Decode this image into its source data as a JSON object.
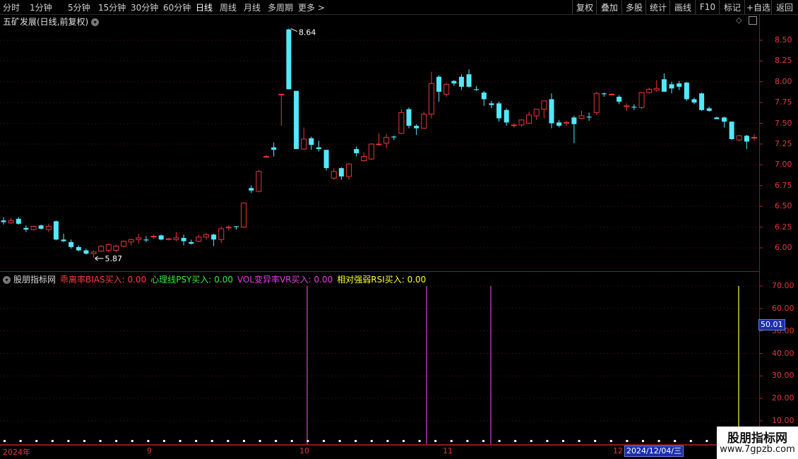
{
  "toolbar": {
    "periods": [
      "分时",
      "1分钟",
      "5分钟",
      "15分钟",
      "30分钟",
      "60分钟",
      "日线",
      "周线",
      "月线",
      "多周期",
      "更多 >"
    ],
    "active_period": "日线",
    "right_buttons": [
      "复权",
      "叠加",
      "多股",
      "统计",
      "画线",
      "F10",
      "标记",
      "+自选",
      "返回"
    ]
  },
  "chart": {
    "title": "五矿发展(日线,前复权)",
    "high_marker": "8.64",
    "low_marker": "5.87",
    "price_ticks": [
      "8.50",
      "8.25",
      "8.00",
      "7.75",
      "7.50",
      "7.25",
      "7.00",
      "6.75",
      "6.50",
      "6.25",
      "6.00"
    ],
    "colors": {
      "up": "#e23a3a",
      "down": "#54e8ff",
      "magenta": "#e040e0",
      "yellow": "#ffff33"
    }
  },
  "indicator": {
    "name": "股朋指标网",
    "items": [
      {
        "label": "乖离率BIAS买入: 0.00",
        "color": "#ff3b3b"
      },
      {
        "label": "心理线PSY买入: 0.00",
        "color": "#3ce63c"
      },
      {
        "label": "VOL变异率VR买入: 0.00",
        "color": "#e040e0"
      },
      {
        "label": "相对强弱RSI买入: 0.00",
        "color": "#ffff33"
      }
    ],
    "ticks": [
      "70.00",
      "60.00",
      "50.00",
      "40.00",
      "30.00",
      "20.00",
      "10.00"
    ],
    "current_value": "50.01"
  },
  "date_axis": {
    "labels": [
      "2024年",
      "9",
      "10",
      "11",
      "12"
    ],
    "cursor": "2024/12/04/三"
  },
  "watermark": {
    "title": "股朋指标网",
    "url": "www.7gpzb.com"
  },
  "chart_data": {
    "type": "candlestick",
    "title": "五矿发展(日线,前复权)",
    "y_range": [
      5.8,
      8.75
    ],
    "candles": [
      {
        "o": 6.33,
        "h": 6.37,
        "l": 6.28,
        "c": 6.31
      },
      {
        "o": 6.3,
        "h": 6.36,
        "l": 6.29,
        "c": 6.33
      },
      {
        "o": 6.35,
        "h": 6.37,
        "l": 6.28,
        "c": 6.29
      },
      {
        "o": 6.24,
        "h": 6.27,
        "l": 6.19,
        "c": 6.22
      },
      {
        "o": 6.22,
        "h": 6.27,
        "l": 6.21,
        "c": 6.26
      },
      {
        "o": 6.27,
        "h": 6.28,
        "l": 6.22,
        "c": 6.23
      },
      {
        "o": 6.22,
        "h": 6.29,
        "l": 6.19,
        "c": 6.26
      },
      {
        "o": 6.32,
        "h": 6.33,
        "l": 6.09,
        "c": 6.1
      },
      {
        "o": 6.1,
        "h": 6.17,
        "l": 6.07,
        "c": 6.08
      },
      {
        "o": 6.07,
        "h": 6.1,
        "l": 5.99,
        "c": 6.01
      },
      {
        "o": 6.01,
        "h": 6.03,
        "l": 5.96,
        "c": 5.97
      },
      {
        "o": 5.97,
        "h": 5.99,
        "l": 5.92,
        "c": 5.93
      },
      {
        "o": 5.93,
        "h": 5.97,
        "l": 5.88,
        "c": 5.95
      },
      {
        "o": 5.96,
        "h": 6.03,
        "l": 5.95,
        "c": 6.02
      },
      {
        "o": 5.97,
        "h": 6.05,
        "l": 5.95,
        "c": 6.04
      },
      {
        "o": 5.97,
        "h": 6.04,
        "l": 5.95,
        "c": 6.02
      },
      {
        "o": 6.02,
        "h": 6.09,
        "l": 6.01,
        "c": 6.08
      },
      {
        "o": 6.07,
        "h": 6.11,
        "l": 6.03,
        "c": 6.1
      },
      {
        "o": 6.1,
        "h": 6.17,
        "l": 6.05,
        "c": 6.12
      },
      {
        "o": 6.1,
        "h": 6.14,
        "l": 6.07,
        "c": 6.09
      },
      {
        "o": 6.14,
        "h": 6.16,
        "l": 6.11,
        "c": 6.14
      },
      {
        "o": 6.15,
        "h": 6.16,
        "l": 6.09,
        "c": 6.1
      },
      {
        "o": 6.1,
        "h": 6.12,
        "l": 6.09,
        "c": 6.11
      },
      {
        "o": 6.1,
        "h": 6.19,
        "l": 6.08,
        "c": 6.12
      },
      {
        "o": 6.12,
        "h": 6.16,
        "l": 6.03,
        "c": 6.08
      },
      {
        "o": 6.07,
        "h": 6.1,
        "l": 6.04,
        "c": 6.05
      },
      {
        "o": 6.08,
        "h": 6.16,
        "l": 6.07,
        "c": 6.13
      },
      {
        "o": 6.13,
        "h": 6.18,
        "l": 6.1,
        "c": 6.16
      },
      {
        "o": 6.16,
        "h": 6.17,
        "l": 6.02,
        "c": 6.1
      },
      {
        "o": 6.1,
        "h": 6.26,
        "l": 6.06,
        "c": 6.23
      },
      {
        "o": 6.24,
        "h": 6.27,
        "l": 6.21,
        "c": 6.25
      },
      {
        "o": 6.26,
        "h": 6.26,
        "l": 6.22,
        "c": 6.25
      },
      {
        "o": 6.25,
        "h": 6.54,
        "l": 6.24,
        "c": 6.54
      },
      {
        "o": 6.72,
        "h": 6.75,
        "l": 6.66,
        "c": 6.69
      },
      {
        "o": 6.68,
        "h": 6.94,
        "l": 6.67,
        "c": 6.92
      },
      {
        "o": 7.1,
        "h": 7.12,
        "l": 7.1,
        "c": 7.1
      },
      {
        "o": 7.21,
        "h": 7.27,
        "l": 7.1,
        "c": 7.18
      },
      {
        "o": 7.85,
        "h": 7.85,
        "l": 7.47,
        "c": 7.85
      },
      {
        "o": 8.63,
        "h": 8.64,
        "l": 7.91,
        "c": 7.91
      },
      {
        "o": 7.89,
        "h": 7.89,
        "l": 7.23,
        "c": 7.19
      },
      {
        "o": 7.19,
        "h": 7.45,
        "l": 7.18,
        "c": 7.31
      },
      {
        "o": 7.32,
        "h": 7.34,
        "l": 7.18,
        "c": 7.24
      },
      {
        "o": 7.21,
        "h": 7.29,
        "l": 7.16,
        "c": 7.19
      },
      {
        "o": 7.18,
        "h": 7.18,
        "l": 6.93,
        "c": 6.96
      },
      {
        "o": 6.84,
        "h": 6.96,
        "l": 6.82,
        "c": 6.92
      },
      {
        "o": 6.96,
        "h": 6.97,
        "l": 6.82,
        "c": 6.86
      },
      {
        "o": 6.86,
        "h": 7.02,
        "l": 6.82,
        "c": 7.01
      },
      {
        "o": 7.19,
        "h": 7.22,
        "l": 7.1,
        "c": 7.14
      },
      {
        "o": 7.05,
        "h": 7.15,
        "l": 7.04,
        "c": 7.1
      },
      {
        "o": 7.07,
        "h": 7.26,
        "l": 7.06,
        "c": 7.25
      },
      {
        "o": 7.25,
        "h": 7.38,
        "l": 7.23,
        "c": 7.25
      },
      {
        "o": 7.26,
        "h": 7.37,
        "l": 7.2,
        "c": 7.33
      },
      {
        "o": 7.34,
        "h": 7.35,
        "l": 7.3,
        "c": 7.33
      },
      {
        "o": 7.38,
        "h": 7.67,
        "l": 7.37,
        "c": 7.63
      },
      {
        "o": 7.67,
        "h": 7.69,
        "l": 7.44,
        "c": 7.47
      },
      {
        "o": 7.47,
        "h": 7.49,
        "l": 7.36,
        "c": 7.44
      },
      {
        "o": 7.44,
        "h": 7.64,
        "l": 7.44,
        "c": 7.61
      },
      {
        "o": 7.61,
        "h": 8.12,
        "l": 7.56,
        "c": 7.98
      },
      {
        "o": 8.06,
        "h": 8.08,
        "l": 7.76,
        "c": 7.88
      },
      {
        "o": 7.85,
        "h": 7.99,
        "l": 7.82,
        "c": 7.97
      },
      {
        "o": 8.01,
        "h": 8.02,
        "l": 7.95,
        "c": 7.98
      },
      {
        "o": 8.06,
        "h": 8.09,
        "l": 7.9,
        "c": 7.94
      },
      {
        "o": 8.09,
        "h": 8.15,
        "l": 7.93,
        "c": 7.94
      },
      {
        "o": 7.91,
        "h": 7.95,
        "l": 7.89,
        "c": 7.9
      },
      {
        "o": 7.87,
        "h": 7.89,
        "l": 7.71,
        "c": 7.79
      },
      {
        "o": 7.74,
        "h": 7.77,
        "l": 7.68,
        "c": 7.72
      },
      {
        "o": 7.74,
        "h": 7.76,
        "l": 7.52,
        "c": 7.56
      },
      {
        "o": 7.66,
        "h": 7.68,
        "l": 7.47,
        "c": 7.51
      },
      {
        "o": 7.48,
        "h": 7.5,
        "l": 7.45,
        "c": 7.48
      },
      {
        "o": 7.48,
        "h": 7.55,
        "l": 7.46,
        "c": 7.54
      },
      {
        "o": 7.5,
        "h": 7.64,
        "l": 7.49,
        "c": 7.6
      },
      {
        "o": 7.59,
        "h": 7.66,
        "l": 7.54,
        "c": 7.67
      },
      {
        "o": 7.67,
        "h": 7.71,
        "l": 7.56,
        "c": 7.77
      },
      {
        "o": 7.79,
        "h": 7.86,
        "l": 7.44,
        "c": 7.5
      },
      {
        "o": 7.51,
        "h": 7.54,
        "l": 7.45,
        "c": 7.47
      },
      {
        "o": 7.5,
        "h": 7.53,
        "l": 7.47,
        "c": 7.51
      },
      {
        "o": 7.57,
        "h": 7.59,
        "l": 7.26,
        "c": 7.49
      },
      {
        "o": 7.56,
        "h": 7.65,
        "l": 7.55,
        "c": 7.59
      },
      {
        "o": 7.58,
        "h": 7.63,
        "l": 7.53,
        "c": 7.57
      },
      {
        "o": 7.63,
        "h": 7.88,
        "l": 7.6,
        "c": 7.86
      },
      {
        "o": 7.86,
        "h": 7.87,
        "l": 7.82,
        "c": 7.85
      },
      {
        "o": 7.85,
        "h": 7.86,
        "l": 7.84,
        "c": 7.85
      },
      {
        "o": 7.82,
        "h": 7.84,
        "l": 7.73,
        "c": 7.76
      },
      {
        "o": 7.7,
        "h": 7.74,
        "l": 7.65,
        "c": 7.71
      },
      {
        "o": 7.7,
        "h": 7.73,
        "l": 7.66,
        "c": 7.69
      },
      {
        "o": 7.69,
        "h": 7.85,
        "l": 7.67,
        "c": 7.87
      },
      {
        "o": 7.87,
        "h": 7.93,
        "l": 7.86,
        "c": 7.91
      },
      {
        "o": 7.9,
        "h": 8.02,
        "l": 7.88,
        "c": 7.92
      },
      {
        "o": 8.03,
        "h": 8.1,
        "l": 7.88,
        "c": 7.88
      },
      {
        "o": 7.97,
        "h": 8.0,
        "l": 7.86,
        "c": 7.92
      },
      {
        "o": 7.98,
        "h": 8.01,
        "l": 7.9,
        "c": 7.94
      },
      {
        "o": 7.99,
        "h": 8.0,
        "l": 7.77,
        "c": 7.79
      },
      {
        "o": 7.79,
        "h": 7.81,
        "l": 7.73,
        "c": 7.75
      },
      {
        "o": 7.86,
        "h": 7.87,
        "l": 7.65,
        "c": 7.66
      },
      {
        "o": 7.68,
        "h": 7.7,
        "l": 7.64,
        "c": 7.65
      },
      {
        "o": 7.57,
        "h": 7.58,
        "l": 7.55,
        "c": 7.55
      },
      {
        "o": 7.57,
        "h": 7.58,
        "l": 7.45,
        "c": 7.52
      },
      {
        "o": 7.52,
        "h": 7.52,
        "l": 7.3,
        "c": 7.31
      },
      {
        "o": 7.3,
        "h": 7.36,
        "l": 7.28,
        "c": 7.35
      },
      {
        "o": 7.35,
        "h": 7.36,
        "l": 7.19,
        "c": 7.28
      },
      {
        "o": 7.33,
        "h": 7.37,
        "l": 7.29,
        "c": 7.33
      }
    ],
    "signals": [
      {
        "index": 37,
        "series": "VOL变异率VR",
        "value": 70,
        "color": "#e040e0"
      },
      {
        "index": 52,
        "series": "VOL变异率VR",
        "value": 70,
        "color": "#e040e0"
      },
      {
        "index": 60,
        "series": "VOL变异率VR",
        "value": 70,
        "color": "#e040e0"
      },
      {
        "index": 99,
        "series": "相对强弱RSI",
        "value": 70,
        "color": "#ffff33"
      }
    ],
    "indicator_range": [
      0,
      75
    ]
  }
}
